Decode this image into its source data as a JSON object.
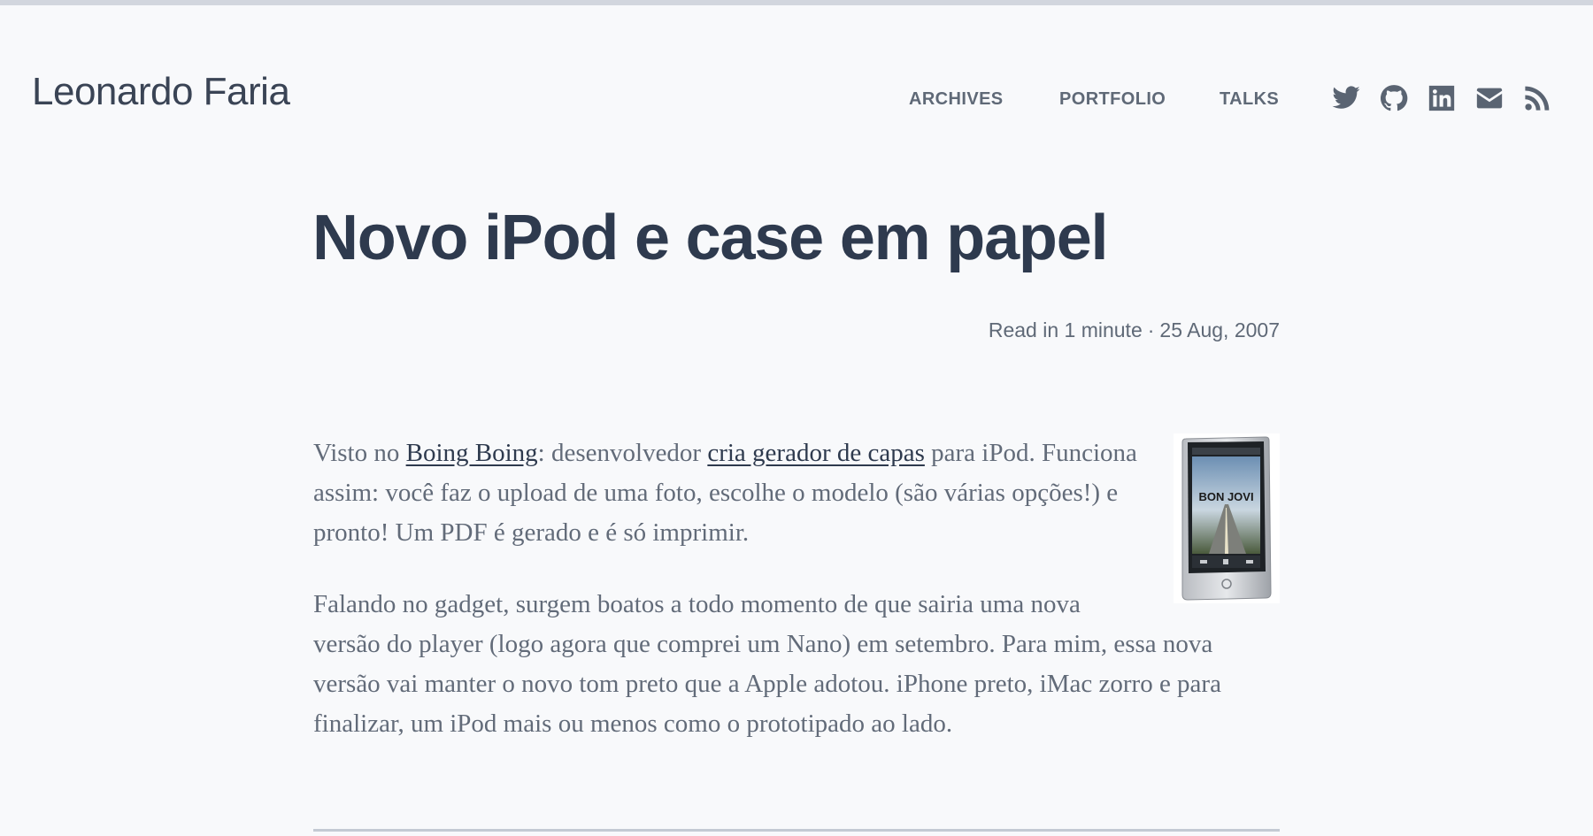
{
  "site": {
    "title": "Leonardo Faria"
  },
  "nav": {
    "items": [
      {
        "label": "ARCHIVES"
      },
      {
        "label": "PORTFOLIO"
      },
      {
        "label": "TALKS"
      }
    ],
    "social_icons": [
      "twitter-icon",
      "github-icon",
      "linkedin-icon",
      "email-icon",
      "rss-icon"
    ]
  },
  "post": {
    "title": "Novo iPod e case em papel",
    "meta": {
      "read_time": "Read in 1 minute",
      "separator": "·",
      "date": "25 Aug, 2007"
    },
    "paragraph1": {
      "text_1": "Visto no ",
      "link_1": "Boing Boing",
      "text_2": ": desenvolvedor ",
      "link_2": "cria gerador de capas",
      "text_3": " para iPod. Funciona assim: você faz o upload de uma foto, escolhe o modelo (são várias opções!) e pronto! Um PDF é gerado e é só imprimir."
    },
    "paragraph2": "Falando no gadget, surgem boatos a todo momento de que sairia uma nova versão do player (logo agora que comprei um Nano) em setembro. Para mim, essa nova versão vai manter o novo tom preto que a Apple adotou. iPhone preto, iMac zorro e para finalizar, um iPod mais ou menos como o prototipado ao lado.",
    "image_text": "BON JOVI"
  },
  "colors": {
    "background": "#f8f9fb",
    "heading": "#2e3a4e",
    "nav": "#5f6977",
    "body_text": "#626b79"
  }
}
